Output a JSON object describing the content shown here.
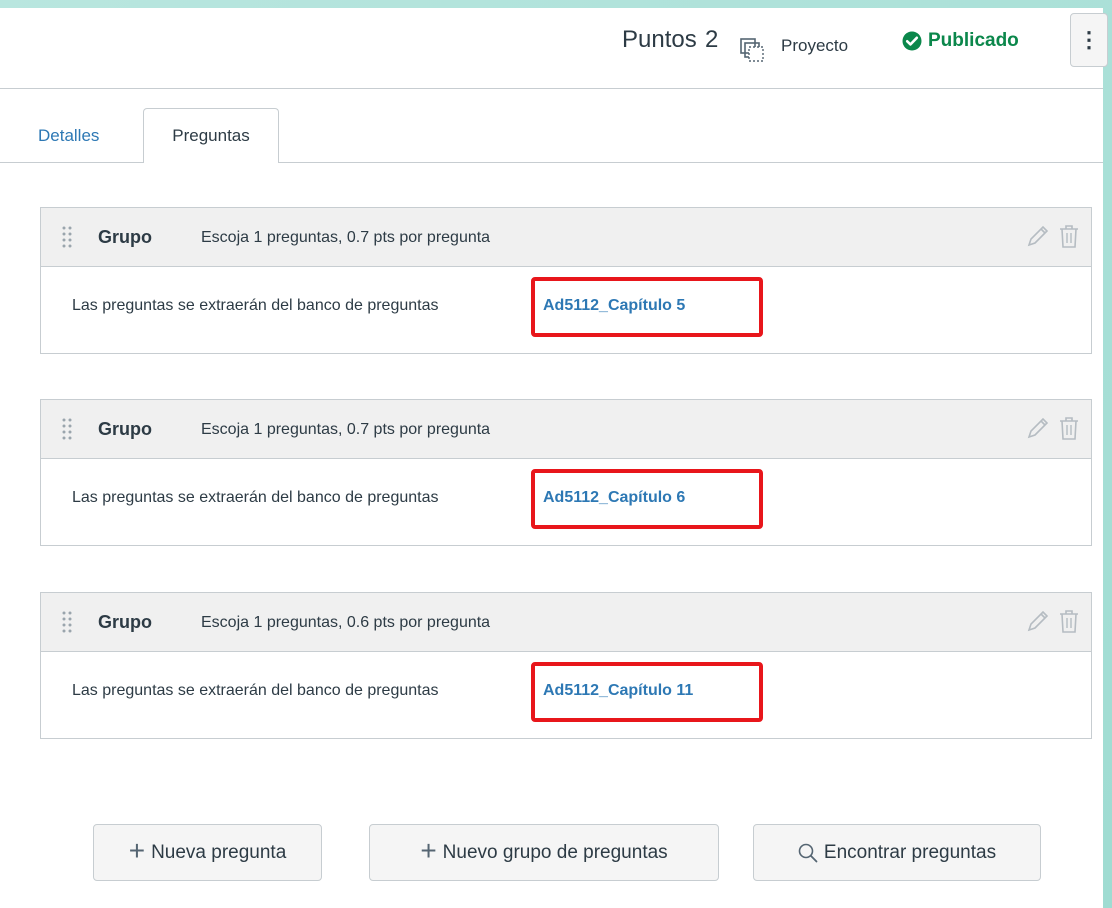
{
  "header": {
    "points_label": "Puntos",
    "points_value": "2",
    "project_icon": "project-icon",
    "project_label": "Proyecto",
    "status_icon": "check-circle-icon",
    "status_label": "Publicado",
    "status_color": "#0b874b",
    "menu_glyph": "⋮"
  },
  "tabs": [
    {
      "label": "Detalles",
      "active": false
    },
    {
      "label": "Preguntas",
      "active": true
    }
  ],
  "groups": [
    {
      "title": "Grupo",
      "description": "Escoja 1 preguntas, 0.7 pts por pregunta",
      "bank_prefix": "Las preguntas se extraerán del banco de preguntas",
      "bank_name": "Ad5112_Capítulo 5"
    },
    {
      "title": "Grupo",
      "description": "Escoja 1 preguntas, 0.7 pts por pregunta",
      "bank_prefix": "Las preguntas se extraerán del banco de preguntas",
      "bank_name": "Ad5112_Capítulo 6"
    },
    {
      "title": "Grupo",
      "description": "Escoja 1 preguntas, 0.6 pts por pregunta",
      "bank_prefix": "Las preguntas se extraerán del banco de preguntas",
      "bank_name": "Ad5112_Capítulo 11"
    }
  ],
  "actions": {
    "new_question": "Nueva pregunta",
    "new_group": "Nuevo grupo de preguntas",
    "find_questions": "Encontrar preguntas"
  },
  "colors": {
    "link": "#2d78b4",
    "highlight": "#e8161b",
    "background": "#9fdcd2"
  }
}
